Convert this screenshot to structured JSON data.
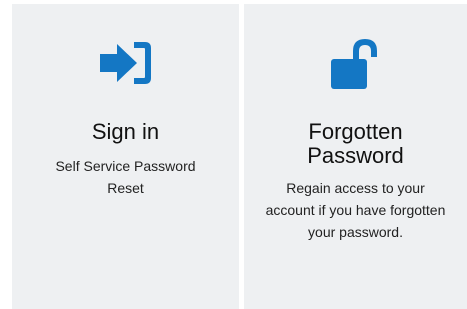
{
  "tiles": [
    {
      "icon": "sign-in-icon",
      "title": "Sign in",
      "description": "Self Service Password Reset"
    },
    {
      "icon": "unlocked-padlock-icon",
      "title": "Forgotten Password",
      "description": "Regain access to your account if you have forgotten your password."
    }
  ],
  "colors": {
    "tile_background": "#eef0f2",
    "icon_blue": "#1477c4",
    "text": "#222222"
  }
}
